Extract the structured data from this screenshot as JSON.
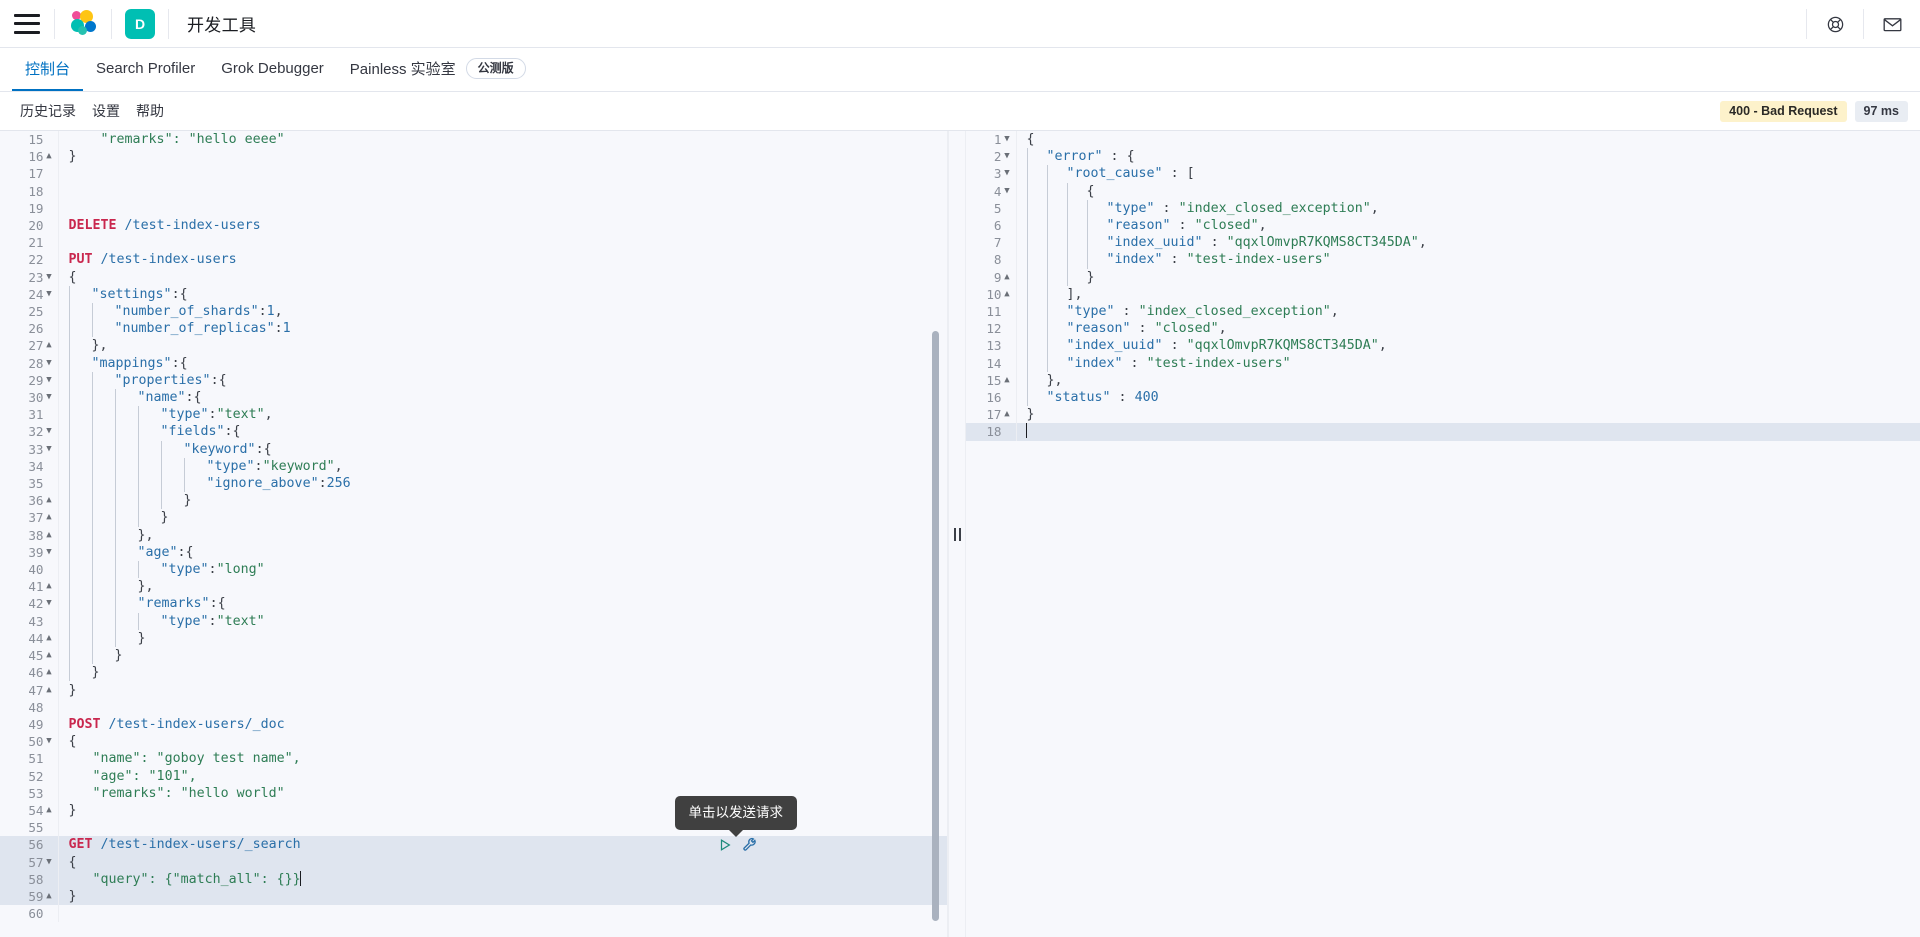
{
  "chrome": {
    "menu_icon": "hamburger-menu-icon",
    "logo_icon": "elastic-logo-icon",
    "space_badge": "D",
    "app_title": "开发工具",
    "help_icon": "help-lifebuoy-icon",
    "mail_icon": "mail-envelope-icon"
  },
  "app_tabs": [
    {
      "label": "控制台",
      "active": true,
      "pill": null
    },
    {
      "label": "Search Profiler",
      "active": false,
      "pill": null
    },
    {
      "label": "Grok Debugger",
      "active": false,
      "pill": null
    },
    {
      "label": "Painless 实验室",
      "active": false,
      "pill": "公测版"
    }
  ],
  "console_toolbar": {
    "links": [
      "历史记录",
      "设置",
      "帮助"
    ],
    "status_badge": "400 - Bad Request",
    "time_badge": "97 ms",
    "status_color": "#fdf2cb",
    "time_color": "#e9edf3"
  },
  "tooltip": {
    "text": "单击以发送请求"
  },
  "request_actions": {
    "play_icon": "play-send-request-icon",
    "wrench_icon": "wrench-options-icon",
    "play_color": "#1d8a7b",
    "wrench_color": "#2a6fa8"
  },
  "request_editor": {
    "first_visible_line": 15,
    "highlighted_lines": [
      56,
      57,
      58,
      59
    ],
    "cursor_line": 58,
    "lines": [
      {
        "n": 15,
        "fold": "",
        "indent": 0,
        "tokens": [
          {
            "t": "str",
            "v": "    \"remarks\": \"hello eeee\""
          }
        ]
      },
      {
        "n": 16,
        "fold": "▲",
        "indent": 0,
        "tokens": [
          {
            "t": "punc",
            "v": "}"
          }
        ]
      },
      {
        "n": 17,
        "fold": "",
        "indent": 0,
        "tokens": []
      },
      {
        "n": 18,
        "fold": "",
        "indent": 0,
        "tokens": []
      },
      {
        "n": 19,
        "fold": "",
        "indent": 0,
        "tokens": []
      },
      {
        "n": 20,
        "fold": "",
        "indent": 0,
        "tokens": [
          {
            "t": "method",
            "v": "DELETE"
          },
          {
            "t": "url",
            "v": " /test-index-users"
          }
        ]
      },
      {
        "n": 21,
        "fold": "",
        "indent": 0,
        "tokens": []
      },
      {
        "n": 22,
        "fold": "",
        "indent": 0,
        "tokens": [
          {
            "t": "method",
            "v": "PUT"
          },
          {
            "t": "url",
            "v": " /test-index-users"
          }
        ]
      },
      {
        "n": 23,
        "fold": "▼",
        "indent": 0,
        "tokens": [
          {
            "t": "punc",
            "v": "{"
          }
        ]
      },
      {
        "n": 24,
        "fold": "▼",
        "indent": 1,
        "tokens": [
          {
            "t": "key",
            "v": "\"settings\""
          },
          {
            "t": "punc",
            "v": ":{"
          }
        ]
      },
      {
        "n": 25,
        "fold": "",
        "indent": 2,
        "tokens": [
          {
            "t": "key",
            "v": "\"number_of_shards\""
          },
          {
            "t": "punc",
            "v": ":"
          },
          {
            "t": "num",
            "v": "1"
          },
          {
            "t": "punc",
            "v": ","
          }
        ]
      },
      {
        "n": 26,
        "fold": "",
        "indent": 2,
        "tokens": [
          {
            "t": "key",
            "v": "\"number_of_replicas\""
          },
          {
            "t": "punc",
            "v": ":"
          },
          {
            "t": "num",
            "v": "1"
          }
        ]
      },
      {
        "n": 27,
        "fold": "▲",
        "indent": 1,
        "tokens": [
          {
            "t": "punc",
            "v": "},"
          }
        ]
      },
      {
        "n": 28,
        "fold": "▼",
        "indent": 1,
        "tokens": [
          {
            "t": "key",
            "v": "\"mappings\""
          },
          {
            "t": "punc",
            "v": ":{"
          }
        ]
      },
      {
        "n": 29,
        "fold": "▼",
        "indent": 2,
        "tokens": [
          {
            "t": "key",
            "v": "\"properties\""
          },
          {
            "t": "punc",
            "v": ":{"
          }
        ]
      },
      {
        "n": 30,
        "fold": "▼",
        "indent": 3,
        "tokens": [
          {
            "t": "key",
            "v": "\"name\""
          },
          {
            "t": "punc",
            "v": ":{"
          }
        ]
      },
      {
        "n": 31,
        "fold": "",
        "indent": 4,
        "tokens": [
          {
            "t": "key",
            "v": "\"type\""
          },
          {
            "t": "punc",
            "v": ":"
          },
          {
            "t": "str",
            "v": "\"text\""
          },
          {
            "t": "punc",
            "v": ","
          }
        ]
      },
      {
        "n": 32,
        "fold": "▼",
        "indent": 4,
        "tokens": [
          {
            "t": "key",
            "v": "\"fields\""
          },
          {
            "t": "punc",
            "v": ":{"
          }
        ]
      },
      {
        "n": 33,
        "fold": "▼",
        "indent": 5,
        "tokens": [
          {
            "t": "key",
            "v": "\"keyword\""
          },
          {
            "t": "punc",
            "v": ":{"
          }
        ]
      },
      {
        "n": 34,
        "fold": "",
        "indent": 6,
        "tokens": [
          {
            "t": "key",
            "v": "\"type\""
          },
          {
            "t": "punc",
            "v": ":"
          },
          {
            "t": "str",
            "v": "\"keyword\""
          },
          {
            "t": "punc",
            "v": ","
          }
        ]
      },
      {
        "n": 35,
        "fold": "",
        "indent": 6,
        "tokens": [
          {
            "t": "key",
            "v": "\"ignore_above\""
          },
          {
            "t": "punc",
            "v": ":"
          },
          {
            "t": "num",
            "v": "256"
          }
        ]
      },
      {
        "n": 36,
        "fold": "▲",
        "indent": 5,
        "tokens": [
          {
            "t": "punc",
            "v": "}"
          }
        ]
      },
      {
        "n": 37,
        "fold": "▲",
        "indent": 4,
        "tokens": [
          {
            "t": "punc",
            "v": "}"
          }
        ]
      },
      {
        "n": 38,
        "fold": "▲",
        "indent": 3,
        "tokens": [
          {
            "t": "punc",
            "v": "},"
          }
        ]
      },
      {
        "n": 39,
        "fold": "▼",
        "indent": 3,
        "tokens": [
          {
            "t": "key",
            "v": "\"age\""
          },
          {
            "t": "punc",
            "v": ":{"
          }
        ]
      },
      {
        "n": 40,
        "fold": "",
        "indent": 4,
        "tokens": [
          {
            "t": "key",
            "v": "\"type\""
          },
          {
            "t": "punc",
            "v": ":"
          },
          {
            "t": "str",
            "v": "\"long\""
          }
        ]
      },
      {
        "n": 41,
        "fold": "▲",
        "indent": 3,
        "tokens": [
          {
            "t": "punc",
            "v": "},"
          }
        ]
      },
      {
        "n": 42,
        "fold": "▼",
        "indent": 3,
        "tokens": [
          {
            "t": "key",
            "v": "\"remarks\""
          },
          {
            "t": "punc",
            "v": ":{"
          }
        ]
      },
      {
        "n": 43,
        "fold": "",
        "indent": 4,
        "tokens": [
          {
            "t": "key",
            "v": "\"type\""
          },
          {
            "t": "punc",
            "v": ":"
          },
          {
            "t": "str",
            "v": "\"text\""
          }
        ]
      },
      {
        "n": 44,
        "fold": "▲",
        "indent": 3,
        "tokens": [
          {
            "t": "punc",
            "v": "}"
          }
        ]
      },
      {
        "n": 45,
        "fold": "▲",
        "indent": 2,
        "tokens": [
          {
            "t": "punc",
            "v": "}"
          }
        ]
      },
      {
        "n": 46,
        "fold": "▲",
        "indent": 1,
        "tokens": [
          {
            "t": "punc",
            "v": "}"
          }
        ]
      },
      {
        "n": 47,
        "fold": "▲",
        "indent": 0,
        "tokens": [
          {
            "t": "punc",
            "v": "}"
          }
        ]
      },
      {
        "n": 48,
        "fold": "",
        "indent": 0,
        "tokens": []
      },
      {
        "n": 49,
        "fold": "",
        "indent": 0,
        "tokens": [
          {
            "t": "method",
            "v": "POST"
          },
          {
            "t": "url",
            "v": " /test-index-users/_doc"
          }
        ]
      },
      {
        "n": 50,
        "fold": "▼",
        "indent": 0,
        "tokens": [
          {
            "t": "punc",
            "v": "{"
          }
        ]
      },
      {
        "n": 51,
        "fold": "",
        "indent": 0,
        "tokens": [
          {
            "t": "str",
            "v": "   \"name\": \"goboy test name\","
          }
        ]
      },
      {
        "n": 52,
        "fold": "",
        "indent": 0,
        "tokens": [
          {
            "t": "str",
            "v": "   \"age\": \"101\","
          }
        ]
      },
      {
        "n": 53,
        "fold": "",
        "indent": 0,
        "tokens": [
          {
            "t": "str",
            "v": "   \"remarks\": \"hello world\""
          }
        ]
      },
      {
        "n": 54,
        "fold": "▲",
        "indent": 0,
        "tokens": [
          {
            "t": "punc",
            "v": "}"
          }
        ]
      },
      {
        "n": 55,
        "fold": "",
        "indent": 0,
        "tokens": []
      },
      {
        "n": 56,
        "fold": "",
        "indent": 0,
        "tokens": [
          {
            "t": "method",
            "v": "GET"
          },
          {
            "t": "url",
            "v": " /test-index-users/_search"
          }
        ]
      },
      {
        "n": 57,
        "fold": "▼",
        "indent": 0,
        "tokens": [
          {
            "t": "punc",
            "v": "{"
          }
        ]
      },
      {
        "n": 58,
        "fold": "",
        "indent": 0,
        "tokens": [
          {
            "t": "str",
            "v": "   \"query\": {\"match_all\": {}}"
          }
        ],
        "cursor": true
      },
      {
        "n": 59,
        "fold": "▲",
        "indent": 0,
        "tokens": [
          {
            "t": "punc",
            "v": "}"
          }
        ]
      },
      {
        "n": 60,
        "fold": "",
        "indent": 0,
        "tokens": []
      }
    ]
  },
  "response_editor": {
    "highlighted_lines": [
      18
    ],
    "cursor_line": 18,
    "lines": [
      {
        "n": 1,
        "fold": "▼",
        "indent": 0,
        "tokens": [
          {
            "t": "punc",
            "v": "{"
          }
        ]
      },
      {
        "n": 2,
        "fold": "▼",
        "indent": 1,
        "tokens": [
          {
            "t": "key",
            "v": "\"error\""
          },
          {
            "t": "punc",
            "v": " : {"
          }
        ]
      },
      {
        "n": 3,
        "fold": "▼",
        "indent": 2,
        "tokens": [
          {
            "t": "key",
            "v": "\"root_cause\""
          },
          {
            "t": "punc",
            "v": " : ["
          }
        ]
      },
      {
        "n": 4,
        "fold": "▼",
        "indent": 3,
        "tokens": [
          {
            "t": "punc",
            "v": "{"
          }
        ]
      },
      {
        "n": 5,
        "fold": "",
        "indent": 4,
        "tokens": [
          {
            "t": "key",
            "v": "\"type\""
          },
          {
            "t": "punc",
            "v": " : "
          },
          {
            "t": "str",
            "v": "\"index_closed_exception\""
          },
          {
            "t": "punc",
            "v": ","
          }
        ]
      },
      {
        "n": 6,
        "fold": "",
        "indent": 4,
        "tokens": [
          {
            "t": "key",
            "v": "\"reason\""
          },
          {
            "t": "punc",
            "v": " : "
          },
          {
            "t": "str",
            "v": "\"closed\""
          },
          {
            "t": "punc",
            "v": ","
          }
        ]
      },
      {
        "n": 7,
        "fold": "",
        "indent": 4,
        "tokens": [
          {
            "t": "key",
            "v": "\"index_uuid\""
          },
          {
            "t": "punc",
            "v": " : "
          },
          {
            "t": "str",
            "v": "\"qqxlOmvpR7KQMS8CT345DA\""
          },
          {
            "t": "punc",
            "v": ","
          }
        ]
      },
      {
        "n": 8,
        "fold": "",
        "indent": 4,
        "tokens": [
          {
            "t": "key",
            "v": "\"index\""
          },
          {
            "t": "punc",
            "v": " : "
          },
          {
            "t": "str",
            "v": "\"test-index-users\""
          }
        ]
      },
      {
        "n": 9,
        "fold": "▲",
        "indent": 3,
        "tokens": [
          {
            "t": "punc",
            "v": "}"
          }
        ]
      },
      {
        "n": 10,
        "fold": "▲",
        "indent": 2,
        "tokens": [
          {
            "t": "punc",
            "v": "],"
          }
        ]
      },
      {
        "n": 11,
        "fold": "",
        "indent": 2,
        "tokens": [
          {
            "t": "key",
            "v": "\"type\""
          },
          {
            "t": "punc",
            "v": " : "
          },
          {
            "t": "str",
            "v": "\"index_closed_exception\""
          },
          {
            "t": "punc",
            "v": ","
          }
        ]
      },
      {
        "n": 12,
        "fold": "",
        "indent": 2,
        "tokens": [
          {
            "t": "key",
            "v": "\"reason\""
          },
          {
            "t": "punc",
            "v": " : "
          },
          {
            "t": "str",
            "v": "\"closed\""
          },
          {
            "t": "punc",
            "v": ","
          }
        ]
      },
      {
        "n": 13,
        "fold": "",
        "indent": 2,
        "tokens": [
          {
            "t": "key",
            "v": "\"index_uuid\""
          },
          {
            "t": "punc",
            "v": " : "
          },
          {
            "t": "str",
            "v": "\"qqxlOmvpR7KQMS8CT345DA\""
          },
          {
            "t": "punc",
            "v": ","
          }
        ]
      },
      {
        "n": 14,
        "fold": "",
        "indent": 2,
        "tokens": [
          {
            "t": "key",
            "v": "\"index\""
          },
          {
            "t": "punc",
            "v": " : "
          },
          {
            "t": "str",
            "v": "\"test-index-users\""
          }
        ]
      },
      {
        "n": 15,
        "fold": "▲",
        "indent": 1,
        "tokens": [
          {
            "t": "punc",
            "v": "},"
          }
        ]
      },
      {
        "n": 16,
        "fold": "",
        "indent": 1,
        "tokens": [
          {
            "t": "key",
            "v": "\"status\""
          },
          {
            "t": "punc",
            "v": " : "
          },
          {
            "t": "num",
            "v": "400"
          }
        ]
      },
      {
        "n": 17,
        "fold": "▲",
        "indent": 0,
        "tokens": [
          {
            "t": "punc",
            "v": "}"
          }
        ]
      },
      {
        "n": 18,
        "fold": "",
        "indent": 0,
        "tokens": [],
        "cursor": true
      }
    ]
  }
}
